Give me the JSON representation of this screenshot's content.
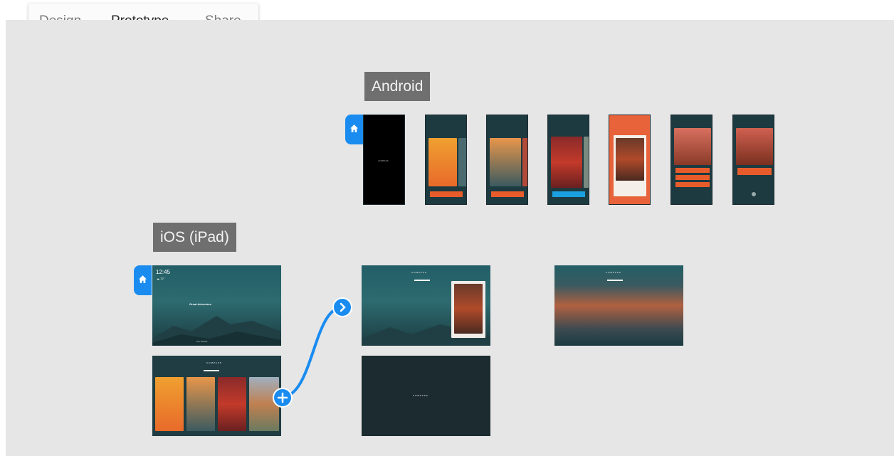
{
  "tabs": [
    {
      "label": "Design",
      "active": false
    },
    {
      "label": "Prototype",
      "active": true
    },
    {
      "label": "Share",
      "active": false
    }
  ],
  "groups": {
    "android": {
      "label": "Android"
    },
    "ios": {
      "label": "iOS (iPad)"
    }
  },
  "ios_home": {
    "time": "12:45",
    "weather": "☁ 72°",
    "headline": "Great Adventure",
    "footer": "Get Started"
  },
  "compass_label": "COMPASS",
  "colors": {
    "accent": "#1a8cf0",
    "orange": "#e85c2c",
    "teal": "#235e66"
  },
  "icons": [
    "home-icon",
    "chevron-right-icon",
    "plus-icon"
  ]
}
